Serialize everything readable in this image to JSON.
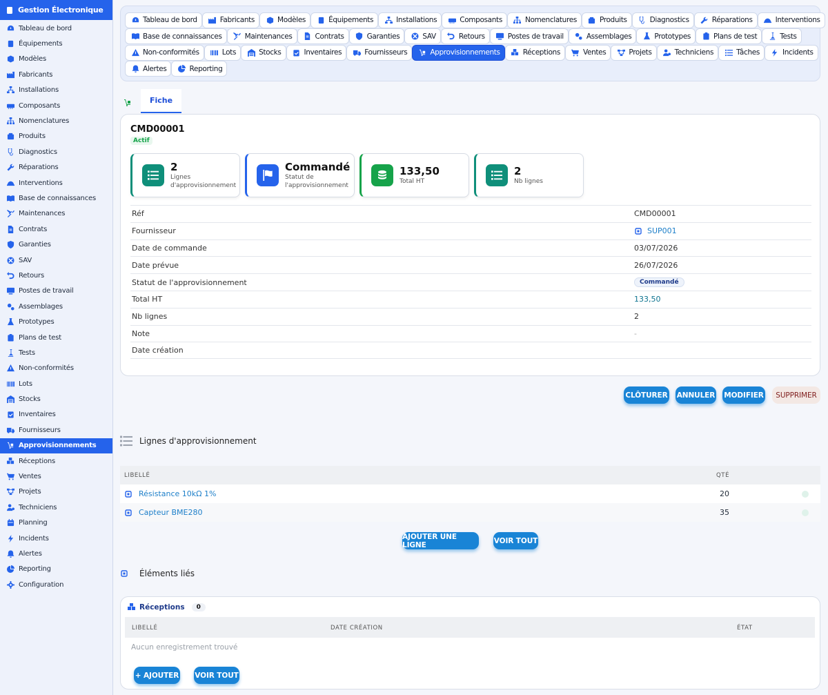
{
  "app": {
    "title": "Gestion Électronique"
  },
  "sidebar": {
    "items": [
      {
        "label": "Tableau de bord",
        "icon": "dashboard-icon"
      },
      {
        "label": "Équipements",
        "icon": "cube-icon"
      },
      {
        "label": "Modèles",
        "icon": "box-icon"
      },
      {
        "label": "Fabricants",
        "icon": "industry-icon"
      },
      {
        "label": "Installations",
        "icon": "sitemap-icon"
      },
      {
        "label": "Composants",
        "icon": "memory-icon"
      },
      {
        "label": "Nomenclatures",
        "icon": "hierarchy-icon"
      },
      {
        "label": "Produits",
        "icon": "product-box-icon"
      },
      {
        "label": "Diagnostics",
        "icon": "stethoscope-icon"
      },
      {
        "label": "Réparations",
        "icon": "wrench-icon"
      },
      {
        "label": "Interventions",
        "icon": "hard-hat-icon"
      },
      {
        "label": "Base de connaissances",
        "icon": "book-icon"
      },
      {
        "label": "Maintenances",
        "icon": "tools-icon"
      },
      {
        "label": "Contrats",
        "icon": "document-icon"
      },
      {
        "label": "Garanties",
        "icon": "shield-icon"
      },
      {
        "label": "SAV",
        "icon": "support-icon"
      },
      {
        "label": "Retours",
        "icon": "undo-icon"
      },
      {
        "label": "Postes de travail",
        "icon": "monitor-icon"
      },
      {
        "label": "Assemblages",
        "icon": "gears-icon"
      },
      {
        "label": "Prototypes",
        "icon": "flask-icon"
      },
      {
        "label": "Plans de test",
        "icon": "clipboard-icon"
      },
      {
        "label": "Tests",
        "icon": "vial-icon"
      },
      {
        "label": "Non-conformités",
        "icon": "warning-icon"
      },
      {
        "label": "Lots",
        "icon": "barcode-icon"
      },
      {
        "label": "Stocks",
        "icon": "warehouse-icon"
      },
      {
        "label": "Inventaires",
        "icon": "clipboard-check-icon"
      },
      {
        "label": "Fournisseurs",
        "icon": "truck-icon"
      },
      {
        "label": "Approvisionnements",
        "icon": "dolly-icon",
        "active": true
      },
      {
        "label": "Réceptions",
        "icon": "boxes-icon"
      },
      {
        "label": "Ventes",
        "icon": "cart-icon"
      },
      {
        "label": "Projets",
        "icon": "project-diagram-icon"
      },
      {
        "label": "Techniciens",
        "icon": "users-cog-icon"
      },
      {
        "label": "Planning",
        "icon": "calendar-icon"
      },
      {
        "label": "Incidents",
        "icon": "bolt-icon"
      },
      {
        "label": "Alertes",
        "icon": "bell-icon"
      },
      {
        "label": "Reporting",
        "icon": "pie-chart-icon"
      },
      {
        "label": "Configuration",
        "icon": "gear-icon"
      }
    ]
  },
  "topnav": {
    "rows": [
      [
        {
          "label": "Tableau de bord",
          "icon": "dashboard-icon"
        },
        {
          "label": "Fabricants",
          "icon": "industry-icon"
        },
        {
          "label": "Modèles",
          "icon": "box-icon"
        },
        {
          "label": "Équipements",
          "icon": "cube-icon"
        },
        {
          "label": "Installations",
          "icon": "sitemap-icon"
        },
        {
          "label": "Composants",
          "icon": "memory-icon"
        },
        {
          "label": "Nomenclatures",
          "icon": "hierarchy-icon"
        },
        {
          "label": "Produits",
          "icon": "product-box-icon"
        },
        {
          "label": "Diagnostics",
          "icon": "stethoscope-icon"
        },
        {
          "label": "Réparations",
          "icon": "wrench-icon"
        },
        {
          "label": "Interventions",
          "icon": "hard-hat-icon"
        }
      ],
      [
        {
          "label": "Base de connaissances",
          "icon": "book-icon"
        },
        {
          "label": "Maintenances",
          "icon": "tools-icon"
        },
        {
          "label": "Contrats",
          "icon": "document-icon"
        },
        {
          "label": "Garanties",
          "icon": "shield-icon"
        },
        {
          "label": "SAV",
          "icon": "support-icon"
        },
        {
          "label": "Retours",
          "icon": "undo-icon"
        },
        {
          "label": "Postes de travail",
          "icon": "monitor-icon"
        },
        {
          "label": "Assemblages",
          "icon": "gears-icon"
        },
        {
          "label": "Prototypes",
          "icon": "flask-icon"
        },
        {
          "label": "Plans de test",
          "icon": "clipboard-icon"
        },
        {
          "label": "Tests",
          "icon": "vial-icon"
        }
      ],
      [
        {
          "label": "Non-conformités",
          "icon": "warning-icon"
        },
        {
          "label": "Lots",
          "icon": "barcode-icon"
        },
        {
          "label": "Stocks",
          "icon": "warehouse-icon"
        },
        {
          "label": "Inventaires",
          "icon": "clipboard-check-icon"
        },
        {
          "label": "Fournisseurs",
          "icon": "truck-icon"
        },
        {
          "label": "Approvisionnements",
          "icon": "dolly-icon",
          "active": true
        },
        {
          "label": "Réceptions",
          "icon": "boxes-icon"
        },
        {
          "label": "Ventes",
          "icon": "cart-icon"
        },
        {
          "label": "Projets",
          "icon": "project-diagram-icon"
        },
        {
          "label": "Techniciens",
          "icon": "users-cog-icon"
        },
        {
          "label": "Tâches",
          "icon": "tasks-icon"
        },
        {
          "label": "Incidents",
          "icon": "bolt-icon"
        }
      ],
      [
        {
          "label": "Alertes",
          "icon": "bell-icon"
        },
        {
          "label": "Reporting",
          "icon": "pie-chart-icon"
        }
      ]
    ]
  },
  "tabs": {
    "fiche": "Fiche"
  },
  "record": {
    "ref": "CMD00001",
    "status_badge": "Actif",
    "kpis": [
      {
        "value": "2",
        "label": "Lignes d'approvisionnement",
        "icon": "list-icon",
        "color": "#0f8f7a",
        "accent": "#0f8f7a"
      },
      {
        "value": "Commandé",
        "label": "Statut de l'approvisionnement",
        "icon": "flag-icon",
        "color": "#2563eb",
        "accent": "#2563eb"
      },
      {
        "value": "133,50",
        "label": "Total HT",
        "icon": "coins-icon",
        "color": "#16a34a",
        "accent": "#16a34a"
      },
      {
        "value": "2",
        "label": "Nb lignes",
        "icon": "list-icon",
        "color": "#0f8f7a",
        "accent": "#0f8f7a"
      }
    ],
    "fields": [
      {
        "label": "Réf",
        "value": "CMD00001"
      },
      {
        "label": "Fournisseur",
        "value": "SUP001",
        "type": "link"
      },
      {
        "label": "Date de commande",
        "value": "03/07/2026"
      },
      {
        "label": "Date prévue",
        "value": "26/07/2026"
      },
      {
        "label": "Statut de l'approvisionnement",
        "value": "Commandé",
        "type": "pill"
      },
      {
        "label": "Total HT",
        "value": "133,50",
        "type": "money"
      },
      {
        "label": "Nb lignes",
        "value": "2"
      },
      {
        "label": "Note",
        "value": "-",
        "type": "muted"
      },
      {
        "label": "Date création",
        "value": ""
      }
    ]
  },
  "actions": {
    "cloturer": "CLÔTURER",
    "annuler": "ANNULER",
    "modifier": "MODIFIER",
    "supprimer": "SUPPRIMER"
  },
  "lines": {
    "title": "Lignes d'approvisionnement",
    "col_libelle": "LIBELLÉ",
    "col_qte": "QTÉ",
    "rows": [
      {
        "libelle": "Résistance 10kΩ 1%",
        "qte": "20"
      },
      {
        "libelle": "Capteur BME280",
        "qte": "35"
      }
    ],
    "add_label": "AJOUTER UNE LIGNE",
    "view_all_label": "VOIR TOUT"
  },
  "linked": {
    "title": "Éléments liés",
    "receptions": {
      "title": "Réceptions",
      "count": "0",
      "col_libelle": "LIBELLÉ",
      "col_date": "DATE CRÉATION",
      "col_etat": "ÉTAT",
      "empty": "Aucun enregistrement trouvé",
      "add_label": "+ AJOUTER",
      "view_all_label": "VOIR TOUT"
    }
  }
}
